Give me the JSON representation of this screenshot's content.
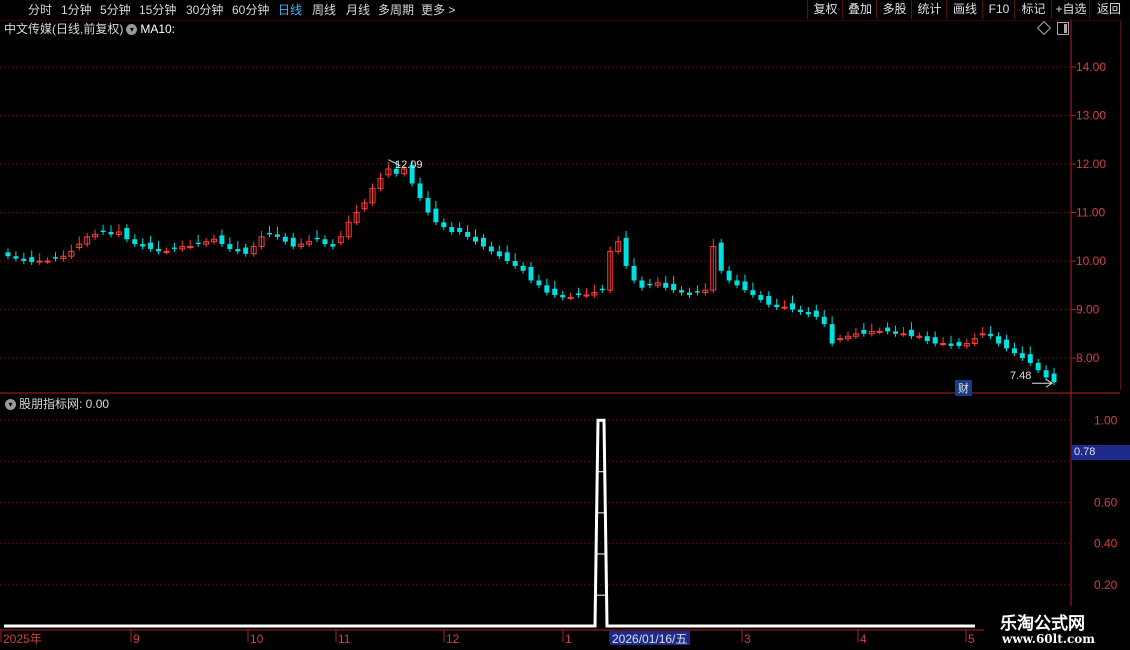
{
  "toolbar": {
    "periods": [
      {
        "label": "分时",
        "active": false
      },
      {
        "label": "1分钟",
        "active": false
      },
      {
        "label": "5分钟",
        "active": false
      },
      {
        "label": "15分钟",
        "active": false
      },
      {
        "label": "30分钟",
        "active": false
      },
      {
        "label": "60分钟",
        "active": false
      },
      {
        "label": "日线",
        "active": true
      },
      {
        "label": "周线",
        "active": false
      },
      {
        "label": "月线",
        "active": false
      },
      {
        "label": "多周期",
        "active": false
      },
      {
        "label": "更多 >",
        "active": false
      }
    ],
    "buttons": [
      "复权",
      "叠加",
      "多股",
      "统计",
      "画线",
      "F10",
      "标记",
      "+自选",
      "返回"
    ]
  },
  "main_header": {
    "title": "中文传媒(日线,前复权)",
    "indicator": "MA10:"
  },
  "sub_header": {
    "indicator": "股朋指标网",
    "value": ": 0.00"
  },
  "price_axis": {
    "ticks": [
      "14.00",
      "13.00",
      "12.00",
      "11.00",
      "10.00",
      "9.00",
      "8.00"
    ]
  },
  "sub_axis": {
    "ticks": [
      "1.00",
      "0.60",
      "0.40",
      "0.20"
    ],
    "cursor_value": "0.78"
  },
  "annotations": {
    "high_label": "12.09",
    "low_label": "7.48",
    "finance_badge": "财"
  },
  "date_axis": {
    "labels": [
      "2025年",
      "9",
      "10",
      "11",
      "12",
      "1",
      "2026/01/16/五",
      "3",
      "4",
      "5"
    ]
  },
  "watermark": {
    "line1": "乐淘公式网",
    "line2": "www.60lt.com"
  },
  "colors": {
    "up": "#ff3c3c",
    "down": "#00e0e0",
    "grid": "#7a1010",
    "signal": "#ffffff",
    "active_tab": "#38b8ff"
  },
  "chart_data": {
    "type": "candlestick",
    "y_range": [
      7.3,
      14.6
    ],
    "closes": [
      10.1,
      10.05,
      10.0,
      9.98,
      10.0,
      10.0,
      10.05,
      10.1,
      10.2,
      10.35,
      10.5,
      10.55,
      10.6,
      10.55,
      10.6,
      10.45,
      10.35,
      10.3,
      10.25,
      10.2,
      10.2,
      10.25,
      10.3,
      10.3,
      10.35,
      10.4,
      10.45,
      10.35,
      10.25,
      10.2,
      10.15,
      10.3,
      10.5,
      10.55,
      10.5,
      10.4,
      10.3,
      10.35,
      10.4,
      10.45,
      10.35,
      10.3,
      10.5,
      10.8,
      11.0,
      11.2,
      11.5,
      11.7,
      11.9,
      11.8,
      11.9,
      11.6,
      11.3,
      11.0,
      10.8,
      10.7,
      10.6,
      10.6,
      10.5,
      10.4,
      10.3,
      10.2,
      10.1,
      10.0,
      9.9,
      9.8,
      9.6,
      9.5,
      9.35,
      9.3,
      9.25,
      9.25,
      9.3,
      9.3,
      9.35,
      9.4,
      10.2,
      10.4,
      9.9,
      9.6,
      9.45,
      9.5,
      9.55,
      9.45,
      9.4,
      9.35,
      9.3,
      9.35,
      9.4,
      10.3,
      9.8,
      9.6,
      9.5,
      9.4,
      9.3,
      9.2,
      9.1,
      9.05,
      9.05,
      9.0,
      8.95,
      8.9,
      8.85,
      8.7,
      8.3,
      8.4,
      8.45,
      8.5,
      8.5,
      8.55,
      8.55,
      8.55,
      8.5,
      8.5,
      8.45,
      8.45,
      8.35,
      8.3,
      8.3,
      8.25,
      8.25,
      8.3,
      8.4,
      8.5,
      8.45,
      8.3,
      8.2,
      8.1,
      8.0,
      7.9,
      7.75,
      7.6,
      7.5
    ],
    "high_marker": 12.09,
    "low_marker": 7.48,
    "signal": {
      "type": "line",
      "peak_value": 1.0,
      "peak_date": "2026/01/16/五",
      "baseline": 0.0
    }
  }
}
